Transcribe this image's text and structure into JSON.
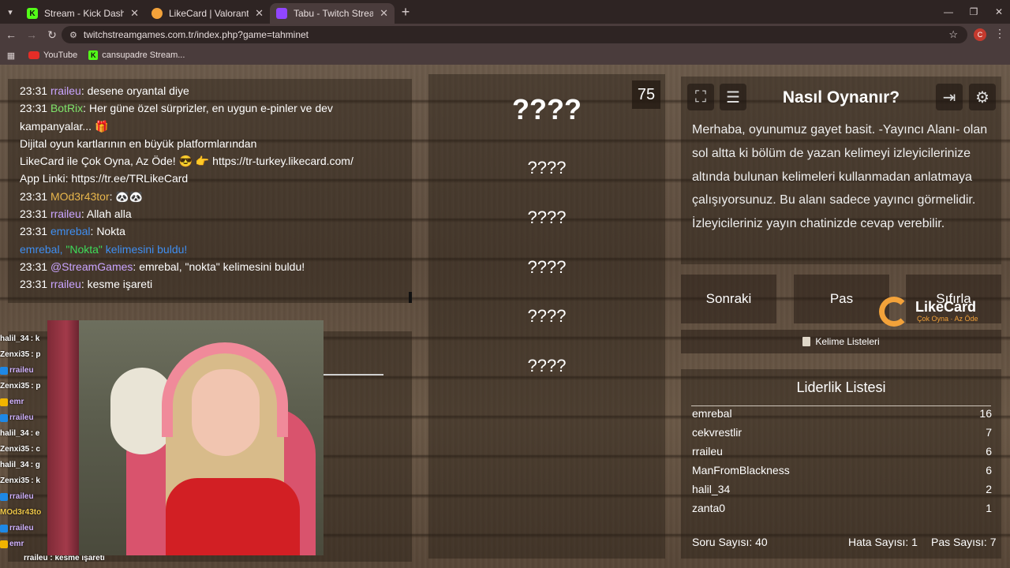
{
  "browser": {
    "tabs": [
      {
        "title": "Stream - Kick Dashboard",
        "active": false
      },
      {
        "title": "LikeCard | Valorant - TR",
        "active": false
      },
      {
        "title": "Tabu - Twitch Stream Games",
        "active": true
      }
    ],
    "url": "twitchstreamgames.com.tr/index.php?game=tahminet",
    "profile_initial": "C",
    "bookmarks": [
      "YouTube",
      "cansupadre Stream..."
    ]
  },
  "chat": {
    "lines": [
      {
        "time": "23:31",
        "user": "rraileu",
        "sep": ": ",
        "text": "desene oryantal diye"
      },
      {
        "time": "23:31",
        "user": "BotRix",
        "sep": ": ",
        "text": "Her güne özel sürprizler, en uygun e-pinler ve dev"
      },
      {
        "time": "",
        "user": "",
        "sep": "",
        "text": "kampanyalar... 🎁"
      },
      {
        "time": "",
        "user": "",
        "sep": "",
        "text": "Dijital oyun kartlarının en büyük platformlarından"
      },
      {
        "time": "",
        "user": "",
        "sep": "",
        "text": "LikeCard ile Çok Oyna, Az Öde! 😎 👉 https://tr-turkey.likecard.com/"
      },
      {
        "time": "",
        "user": "",
        "sep": "",
        "text": "App Linki: https://tr.ee/TRLikeCard"
      },
      {
        "time": "23:31",
        "user": "MOd3r43tor",
        "sep": ": ",
        "text": "🐼🐼"
      },
      {
        "time": "23:31",
        "user": "rraileu",
        "sep": ": ",
        "text": "Allah alla"
      },
      {
        "time": "23:31",
        "user": "emrebal",
        "sep": ": ",
        "text": "Nokta"
      },
      {
        "time": "23:31",
        "user": "@StreamGames",
        "sep": ": ",
        "text": "emrebal, \"nokta\" kelimesini buldu!"
      },
      {
        "time": "23:31",
        "user": "rraileu",
        "sep": ": ",
        "text": "kesme işareti"
      }
    ],
    "system": {
      "user": "emrebal",
      "sep": ", ",
      "word": "\"Nokta\"",
      "text": " kelimesini buldu!"
    }
  },
  "minichat": [
    {
      "user": "halil_34",
      "text": " : k"
    },
    {
      "user": "Zenxi35",
      "text": " : p"
    },
    {
      "user": "rraileu",
      "text": ""
    },
    {
      "user": "Zenxi35",
      "text": " : p"
    },
    {
      "user": "emr",
      "text": ""
    },
    {
      "user": "rraileu",
      "text": ""
    },
    {
      "user": "halil_34",
      "text": " : e"
    },
    {
      "user": "Zenxi35",
      "text": " : c"
    },
    {
      "user": "halil_34",
      "text": " : g"
    },
    {
      "user": "Zenxi35",
      "text": " : k"
    },
    {
      "user": "rraileu",
      "text": ""
    },
    {
      "user": "MOd3r43to",
      "text": ""
    },
    {
      "user": "rraileu",
      "text": ""
    },
    {
      "user": "emr",
      "text": ""
    }
  ],
  "minichat_last": "rraileu : kesme işareti",
  "game": {
    "timer": "75",
    "main_word": "????",
    "forbidden_words": [
      "????",
      "????",
      "????",
      "????",
      "????"
    ]
  },
  "info": {
    "title": "Nasıl Oynanır?",
    "text": "Merhaba, oyunumuz gayet basit. -Yayıncı Alanı- olan sol altta ki bölüm de yazan kelimeyi izleyicilerinize altında bulunan kelimeleri kullanmadan anlatmaya çalışıyorsunuz. Bu alanı sadece yayıncı görmelidir. İzleyicileriniz yayın chatinizde cevap verebilir."
  },
  "buttons": {
    "next": "Sonraki",
    "pass": "Pas",
    "reset": "Sıfırla",
    "word_lists": "Kelime Listeleri"
  },
  "sponsor": {
    "name": "LikeCard",
    "tagline": "Çok Oyna · Az Öde"
  },
  "leaderboard": {
    "title": "Liderlik Listesi",
    "rows": [
      {
        "name": "emrebal",
        "score": "16"
      },
      {
        "name": "cekvrestlir",
        "score": "7"
      },
      {
        "name": "rraileu",
        "score": "6"
      },
      {
        "name": "ManFromBlackness",
        "score": "6"
      },
      {
        "name": "halil_34",
        "score": "2"
      },
      {
        "name": "zanta0",
        "score": "1"
      }
    ]
  },
  "stats": {
    "questions": "Soru Sayısı: 40",
    "errors": "Hata Sayısı: 1",
    "passes": "Pas Sayısı: 7"
  }
}
